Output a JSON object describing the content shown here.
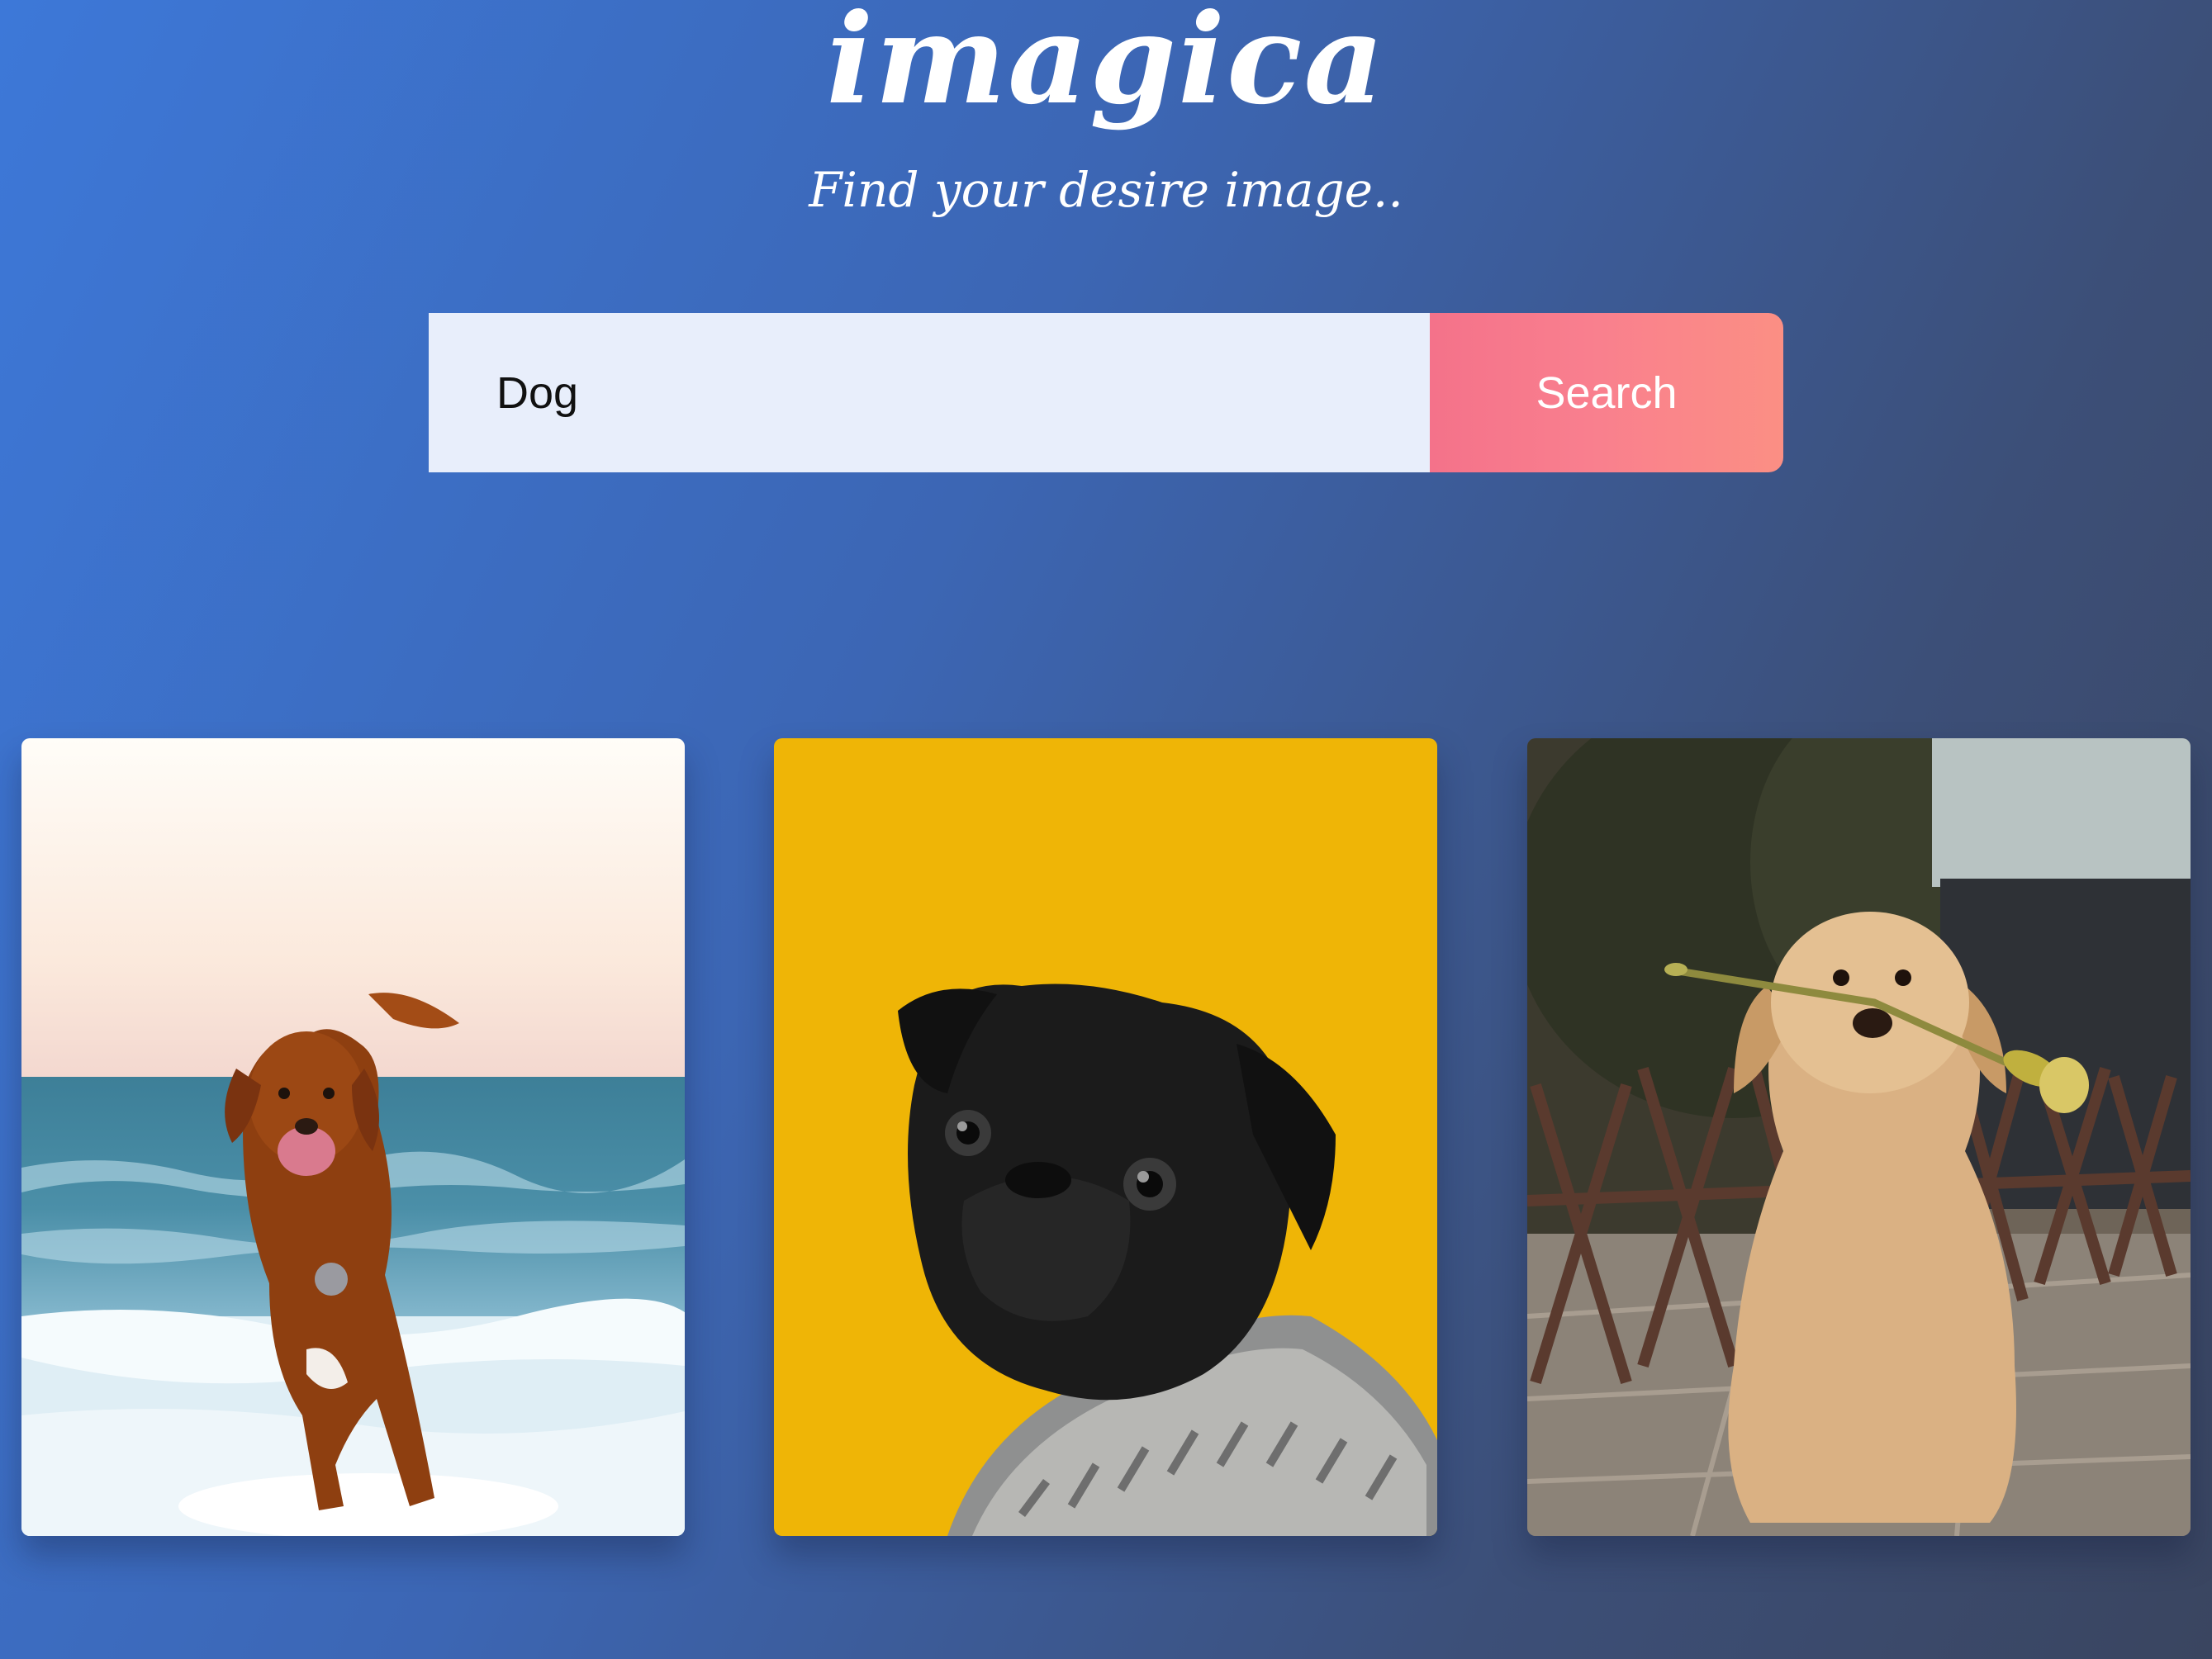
{
  "header": {
    "logo_text": "imagica",
    "tagline": "Find your desire image.."
  },
  "search": {
    "value": "Dog",
    "button_label": "Search"
  },
  "results": [
    {
      "subject": "dog-running-on-beach"
    },
    {
      "subject": "black-pug-on-yellow-background"
    },
    {
      "subject": "golden-puppy-holding-flower"
    }
  ],
  "colors": {
    "accent": "#f97f8e",
    "input_bg": "#e8eefb",
    "pug_background": "#efb506"
  }
}
